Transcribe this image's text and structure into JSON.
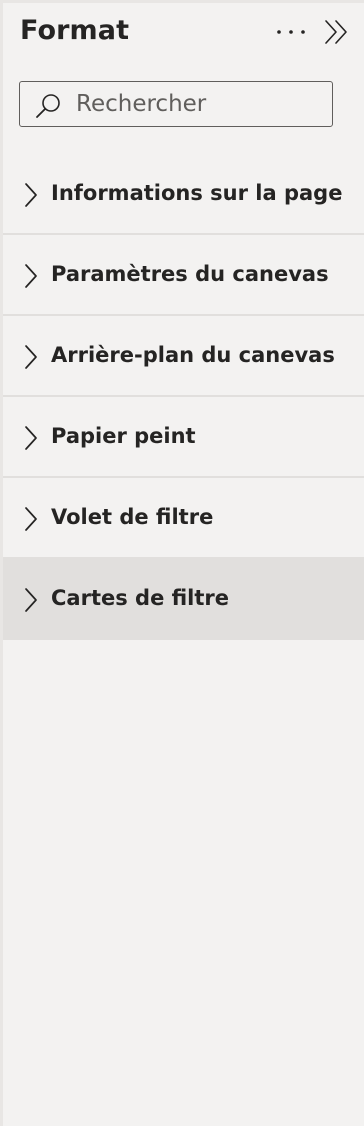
{
  "header": {
    "title": "Format",
    "more_icon": "more-options-icon",
    "collapse_icon": "double-chevron-right-icon"
  },
  "search": {
    "placeholder": "Rechercher",
    "value": "",
    "icon": "search-icon"
  },
  "sections": [
    {
      "label": "Informations sur la page",
      "expanded": false,
      "active": false
    },
    {
      "label": "Paramètres du canevas",
      "expanded": false,
      "active": false
    },
    {
      "label": "Arrière-plan du canevas",
      "expanded": false,
      "active": false
    },
    {
      "label": "Papier peint",
      "expanded": false,
      "active": false
    },
    {
      "label": "Volet de filtre",
      "expanded": false,
      "active": false
    },
    {
      "label": "Cartes de filtre",
      "expanded": false,
      "active": true
    }
  ],
  "colors": {
    "pane_background": "#f3f2f1",
    "active_row": "#e1dfdd",
    "divider": "#e1dfdd",
    "text": "#252423"
  }
}
